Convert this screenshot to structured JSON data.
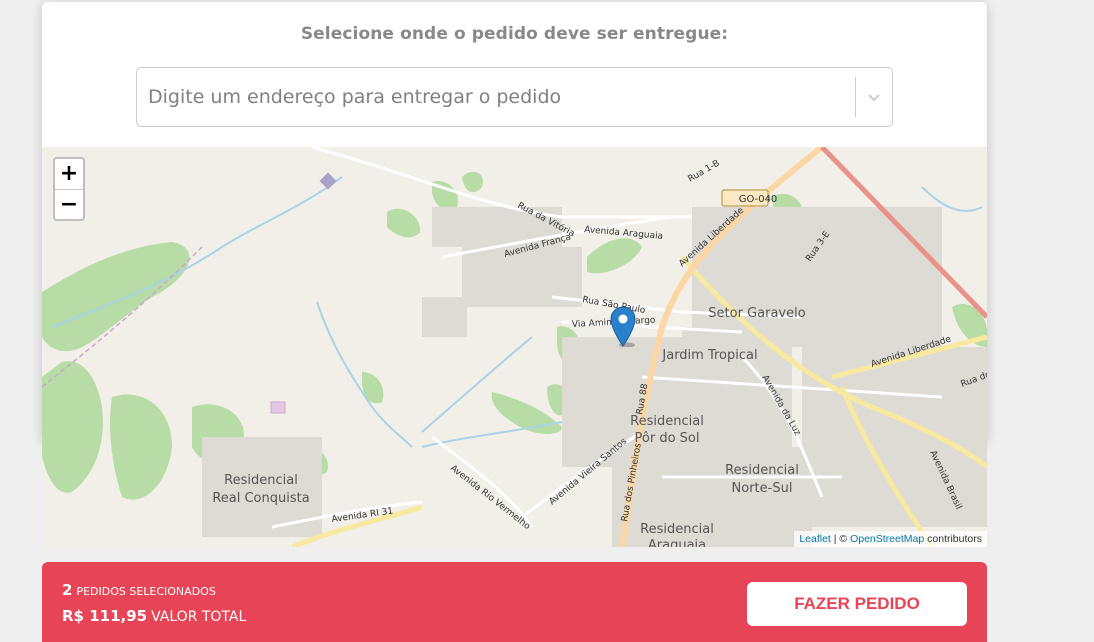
{
  "header": {
    "title": "Selecione onde o pedido deve ser entregue:"
  },
  "address_select": {
    "placeholder": "Digite um endereço para entregar o pedido"
  },
  "map": {
    "zoom_in": "+",
    "zoom_out": "−",
    "attribution": {
      "leaflet": "Leaflet",
      "sep": " | © ",
      "osm": "OpenStreetMap",
      "suffix": " contributors"
    },
    "labels": {
      "setor_garavelo": "Setor Garavelo",
      "jardim_tropical": "Jardim Tropical",
      "res_por_do_sol_1": "Residencial",
      "res_por_do_sol_2": "Pôr do Sol",
      "res_norte_sul_1": "Residencial",
      "res_norte_sul_2": "Norte-Sul",
      "res_real_1": "Residencial",
      "res_real_2": "Real Conquista",
      "res_araguaia_1": "Residencial",
      "res_araguaia_2": "Araguaia",
      "go040": "GO-040",
      "rua_vitoria": "Rua da Vitória",
      "av_franca": "Avenida França",
      "av_araguaia": "Avenida Araguaia",
      "av_liberdade": "Avenida Liberdade",
      "av_liberdade2": "Avenida Liberdade",
      "rua_sao": "Rua São Paulo",
      "via_amin": "Via Amin Camargo",
      "rua1b": "Rua 1-B",
      "rua3e": "Rua 3-E",
      "rua88": "Rua 88",
      "av_luz": "Avenida da Luz",
      "av_brasil": "Avenida Brasil",
      "av_rio": "Avenida Rio Vermelho",
      "av_vieira": "Avenida Vieira Santos",
      "rua_pinheiros": "Rua dos Pinheiros",
      "av_ri31": "Avenida RI 31",
      "rua_do": "Rua do"
    }
  },
  "footer": {
    "count": "2",
    "count_label": "PEDIDOS SELECIONADOS",
    "total": "R$ 111,95",
    "total_label": "VALOR TOTAL",
    "order_button": "FAZER PEDIDO"
  },
  "colors": {
    "accent": "#e84457",
    "map_bg": "#f2efe9",
    "park": "#b5dca2",
    "major_road": "#fcd6a4",
    "motorway": "#e8928a"
  }
}
